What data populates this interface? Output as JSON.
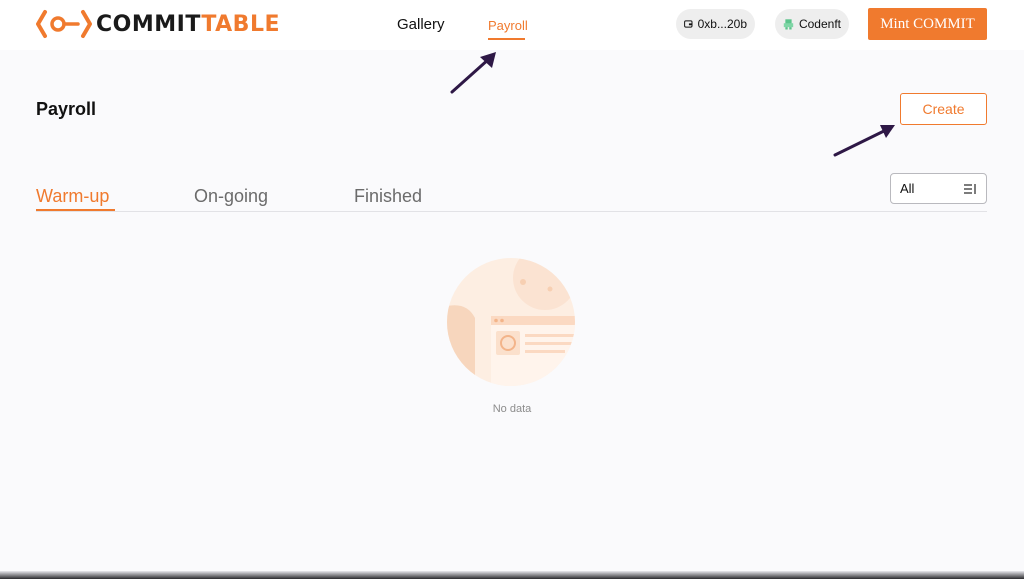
{
  "brand": {
    "name_prefix": "COMMIT",
    "name_suffix": "TABLE",
    "accent_color": "#f07a2e"
  },
  "nav": {
    "gallery": "Gallery",
    "payroll": "Payroll"
  },
  "wallet": {
    "address": "0xb...20b"
  },
  "user": {
    "name": "Codenft"
  },
  "mint_button": "Mint COMMIT",
  "page": {
    "title": "Payroll",
    "create_button": "Create"
  },
  "tabs": [
    {
      "label": "Warm-up",
      "active": true
    },
    {
      "label": "On-going",
      "active": false
    },
    {
      "label": "Finished",
      "active": false
    }
  ],
  "filter": {
    "selected": "All",
    "icon": "sort-icon"
  },
  "empty_state": {
    "text": "No data",
    "icon": "empty-box-illustration"
  },
  "annotations": {
    "arrow_color": "#2e1846"
  }
}
